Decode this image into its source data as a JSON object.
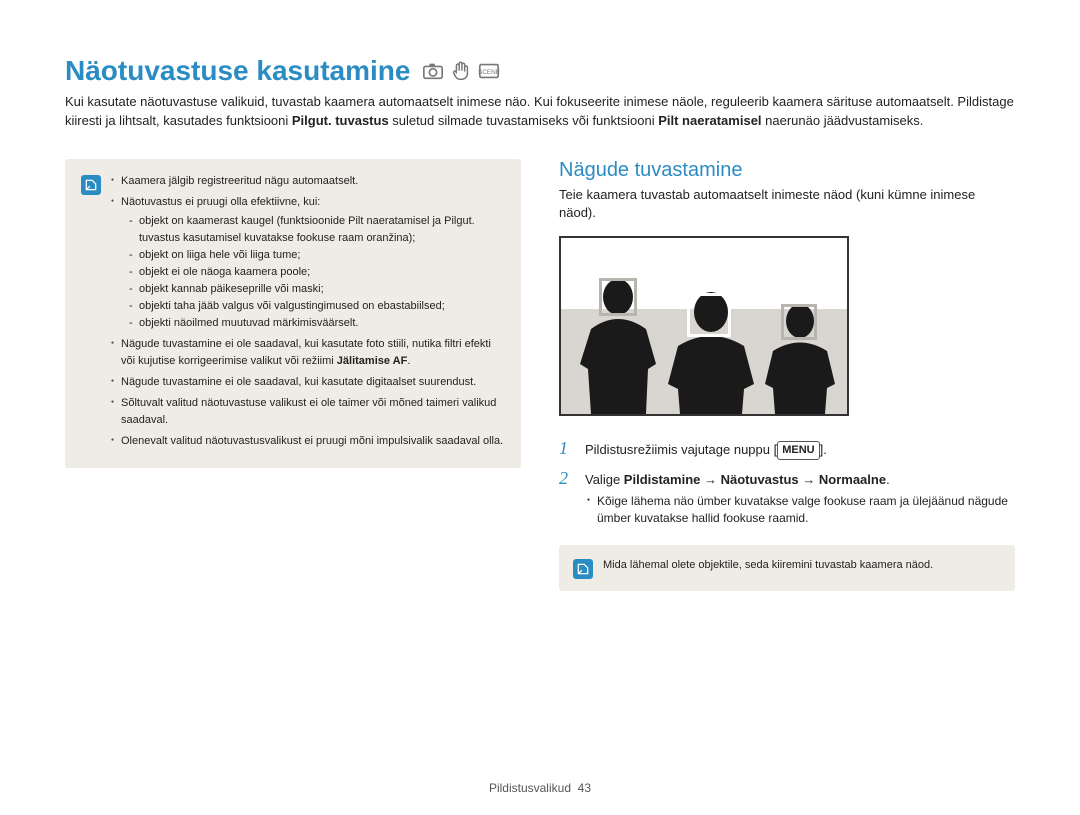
{
  "title": "Näotuvastuse kasutamine",
  "intro_parts": {
    "t1": "Kui kasutate näotuvastuse valikuid, tuvastab kaamera automaatselt inimese näo. Kui fokuseerite inimese näole, reguleerib kaamera särituse automaatselt. Pildistage kiiresti ja lihtsalt, kasutades funktsiooni ",
    "b1": "Pilgut. tuvastus",
    "t2": " suletud silmade tuvastamiseks või funktsiooni ",
    "b2": "Pilt naeratamisel",
    "t3": " naerunäo jäädvustamiseks."
  },
  "left_note": {
    "li1": "Kaamera jälgib registreeritud nägu automaatselt.",
    "li2": "Näotuvastus ei pruugi olla efektiivne, kui:",
    "li2_sub": {
      "a": "objekt on kaamerast kaugel (funktsioonide Pilt naeratamisel ja Pilgut. tuvastus kasutamisel kuvatakse fookuse raam oranžina);",
      "b": "objekt on liiga hele või liiga tume;",
      "c": "objekt ei ole näoga kaamera poole;",
      "d": "objekt kannab päikeseprille või maski;",
      "e": "objekti taha jääb valgus või valgustingimused on ebastabiilsed;",
      "f": "objekti näoilmed muutuvad märkimisväärselt."
    },
    "li3_a": "Nägude tuvastamine ei ole saadaval, kui kasutate foto stiili, nutika filtri efekti või kujutise korrigeerimise valikut või režiimi ",
    "li3_b": "Jälitamise AF",
    "li3_c": ".",
    "li4": "Nägude tuvastamine ei ole saadaval, kui kasutate digitaalset suurendust.",
    "li5": "Sõltuvalt valitud näotuvastuse valikust ei ole taimer või mõned taimeri valikud saadaval.",
    "li6": "Olenevalt valitud näotuvastusvalikust ei pruugi mõni impulsivalik saadaval olla."
  },
  "right": {
    "heading": "Nägude tuvastamine",
    "subtext": "Teie kaamera tuvastab automaatselt inimeste näod (kuni kümne inimese näod).",
    "step1_a": "Pildistusrežiimis vajutage nuppu [",
    "step1_menu": "MENU",
    "step1_b": "].",
    "step2_a": "Valige ",
    "step2_b": "Pildistamine",
    "step2_arrow1": " → ",
    "step2_c": "Näotuvastus",
    "step2_arrow2": " → ",
    "step2_d": "Normaalne",
    "step2_e": ".",
    "step2_bullet": "Kõige lähema näo ümber kuvatakse valge fookuse raam ja ülejäänud nägude ümber kuvatakse hallid fookuse raamid.",
    "note2": "Mida lähemal olete objektile, seda kiiremini tuvastab kaamera näod."
  },
  "footer": {
    "label": "Pildistusvalikud",
    "page": "43"
  }
}
